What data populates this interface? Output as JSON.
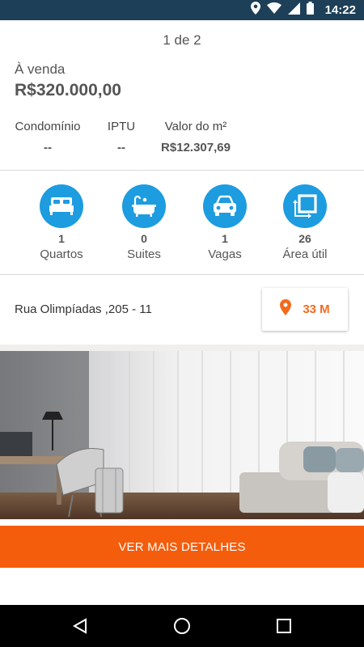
{
  "status_bar": {
    "time": "14:22",
    "icons": [
      "location-icon",
      "wifi-icon",
      "signal-icon",
      "battery-icon"
    ]
  },
  "pager": {
    "text": "1 de 2"
  },
  "listing": {
    "sale_label": "À venda",
    "price": "R$320.000,00",
    "fees": [
      {
        "label": "Condomínio",
        "value": "--"
      },
      {
        "label": "IPTU",
        "value": "--"
      },
      {
        "label": "Valor do m²",
        "value": "R$12.307,69"
      }
    ],
    "features": [
      {
        "icon": "bed-icon",
        "count": "1",
        "label": "Quartos"
      },
      {
        "icon": "bathtub-icon",
        "count": "0",
        "label": "Suites"
      },
      {
        "icon": "car-icon",
        "count": "1",
        "label": "Vagas"
      },
      {
        "icon": "area-icon",
        "count": "26",
        "label": "Área útil"
      }
    ],
    "address": "Rua Olimpíadas ,205 - 11",
    "distance": "33 M",
    "cta_label": "VER MAIS DETALHES"
  },
  "colors": {
    "accent": "#f45d0c",
    "feature_icon_bg": "#1d9ce0",
    "status_bar": "#1d3f58"
  },
  "nav_bar": {
    "buttons": [
      "back-icon",
      "home-icon",
      "recents-icon"
    ]
  }
}
